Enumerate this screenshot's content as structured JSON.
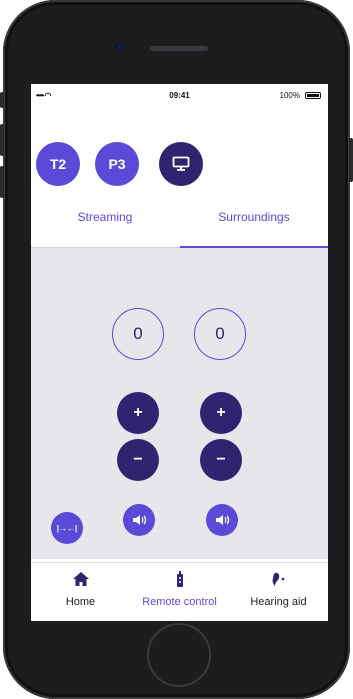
{
  "status_bar": {
    "time": "09:41",
    "battery": "100%",
    "signal": "•••• ◠"
  },
  "programs": [
    {
      "label": "T2"
    },
    {
      "label": "P3"
    },
    {
      "label": "",
      "icon": "tv-icon"
    }
  ],
  "tabs": [
    {
      "label": "Streaming",
      "active": false
    },
    {
      "label": "Surroundings",
      "active": true
    }
  ],
  "volume": {
    "left": {
      "value": "0",
      "plus": "+",
      "minus": "−"
    },
    "right": {
      "value": "0",
      "plus": "+",
      "minus": "−"
    }
  },
  "controls": {
    "split_icon": "|→←|"
  },
  "nav": [
    {
      "label": "Home",
      "icon": "home-icon",
      "active": false
    },
    {
      "label": "Remote control",
      "icon": "remote-icon",
      "active": true
    },
    {
      "label": "Hearing aid",
      "icon": "hearing-aid-icon",
      "active": false
    }
  ],
  "colors": {
    "accent": "#5b4ad7",
    "dark_accent": "#2f2470",
    "panel": "#e8e6ea"
  }
}
